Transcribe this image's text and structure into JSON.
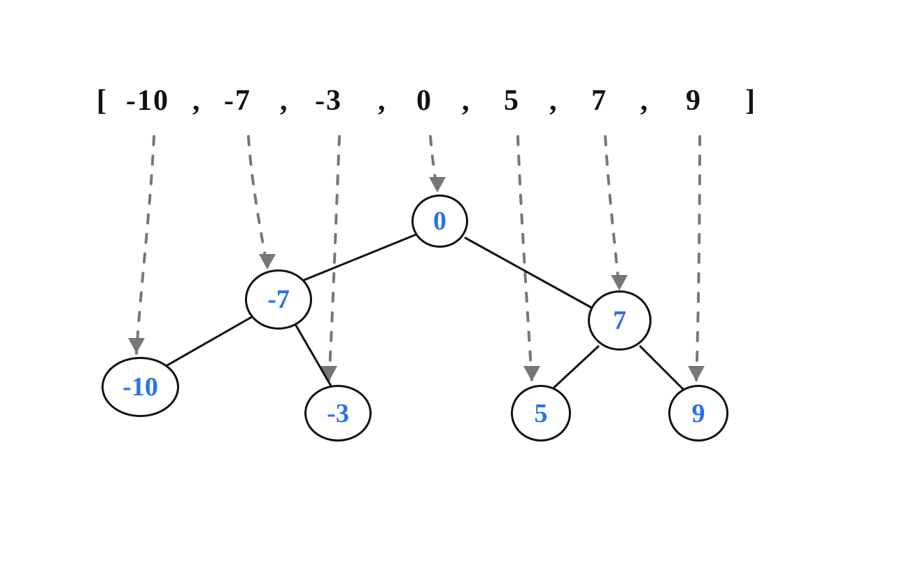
{
  "array": {
    "open_bracket": "[",
    "items": [
      "-10",
      "-7",
      "-3",
      "0",
      "5",
      "7",
      "9"
    ],
    "separator": ",",
    "close_bracket": "]"
  },
  "tree": {
    "root": {
      "value": "0"
    },
    "left": {
      "value": "-7",
      "left": {
        "value": "-10"
      },
      "right": {
        "value": "-3"
      }
    },
    "right": {
      "value": "7",
      "left": {
        "value": "5"
      },
      "right": {
        "value": "9"
      }
    }
  },
  "chart_data": {
    "type": "tree",
    "input_array": [
      -10,
      -7,
      -3,
      0,
      5,
      7,
      9
    ],
    "nodes": [
      {
        "id": "root",
        "value": 0
      },
      {
        "id": "L",
        "value": -7,
        "parent": "root",
        "side": "left"
      },
      {
        "id": "R",
        "value": 7,
        "parent": "root",
        "side": "right"
      },
      {
        "id": "LL",
        "value": -10,
        "parent": "L",
        "side": "left"
      },
      {
        "id": "LR",
        "value": -3,
        "parent": "L",
        "side": "right"
      },
      {
        "id": "RL",
        "value": 5,
        "parent": "R",
        "side": "left"
      },
      {
        "id": "RR",
        "value": 9,
        "parent": "R",
        "side": "right"
      }
    ],
    "mapping_arrows": [
      {
        "from_index": 0,
        "to_node": "LL"
      },
      {
        "from_index": 1,
        "to_node": "L"
      },
      {
        "from_index": 2,
        "to_node": "LR"
      },
      {
        "from_index": 3,
        "to_node": "root"
      },
      {
        "from_index": 4,
        "to_node": "RL"
      },
      {
        "from_index": 5,
        "to_node": "R"
      },
      {
        "from_index": 6,
        "to_node": "RR"
      }
    ]
  }
}
